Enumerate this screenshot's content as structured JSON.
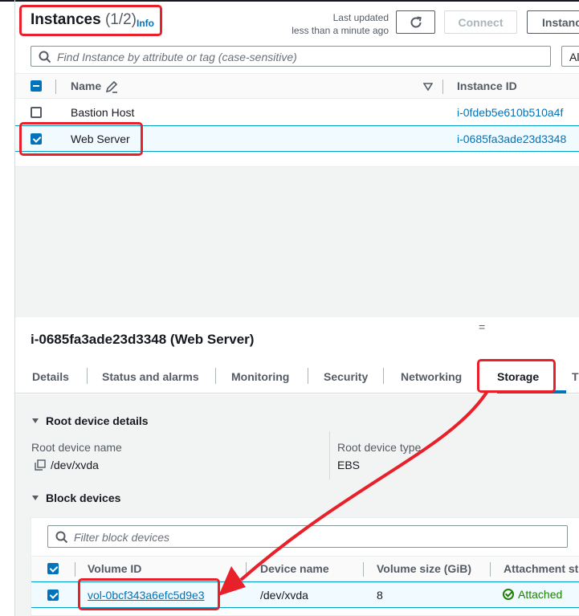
{
  "header": {
    "title": "Instances",
    "count": "(1/2)",
    "info_link": "Info",
    "last_updated_line1": "Last updated",
    "last_updated_line2": "less than a minute ago",
    "connect_label": "Connect",
    "instance_state_label": "Instanc"
  },
  "search": {
    "placeholder": "Find Instance by attribute or tag (case-sensitive)",
    "filter_select_value": "Al"
  },
  "table": {
    "columns": [
      "Name",
      "Instance ID"
    ],
    "rows": [
      {
        "name": "Bastion Host",
        "instance_id": "i-0fdeb5e610b510a4f",
        "selected": false
      },
      {
        "name": "Web Server",
        "instance_id": "i-0685fa3ade23d3348",
        "selected": true
      }
    ]
  },
  "details": {
    "splitter_glyph": "=",
    "title": "i-0685fa3ade23d3348 (Web Server)",
    "tabs": [
      "Details",
      "Status and alarms",
      "Monitoring",
      "Security",
      "Networking",
      "Storage",
      "T"
    ],
    "active_tab": "Storage",
    "root_device": {
      "section_title": "Root device details",
      "name_label": "Root device name",
      "name_value": "/dev/xvda",
      "type_label": "Root device type",
      "type_value": "EBS"
    },
    "block_devices": {
      "section_title": "Block devices",
      "filter_placeholder": "Filter block devices",
      "columns": [
        "Volume ID",
        "Device name",
        "Volume size (GiB)",
        "Attachment st"
      ],
      "rows": [
        {
          "volume_id": "vol-0bcf343a6efc5d9e3",
          "device_name": "/dev/xvda",
          "size": "8",
          "status": "Attached"
        }
      ]
    }
  },
  "colors": {
    "link": "#0073bb",
    "annotation_red": "#e8202a",
    "status_green": "#1d8102"
  }
}
